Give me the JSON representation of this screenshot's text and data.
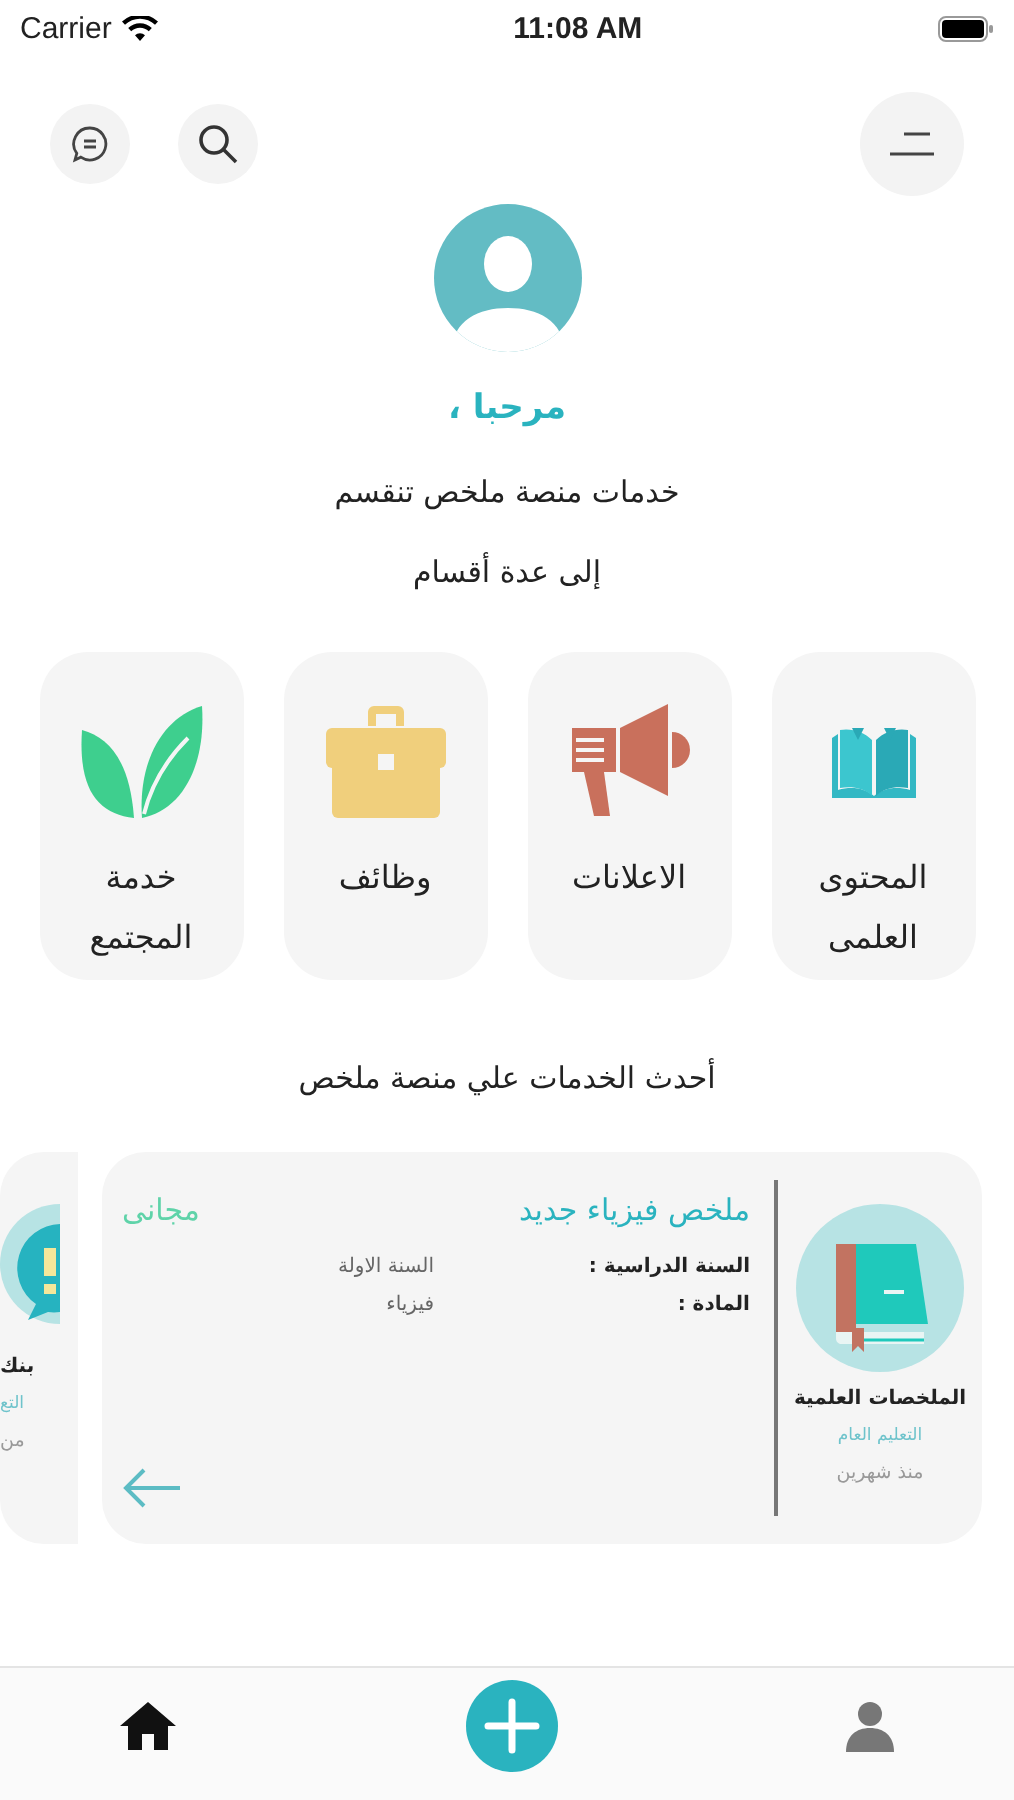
{
  "status_bar": {
    "carrier": "Carrier",
    "time": "11:08 AM"
  },
  "greeting": "مرحبا ،",
  "intro": [
    "خدمات منصة ملخص تنقسم",
    "إلى عدة أقسام"
  ],
  "services": [
    {
      "kind": "book",
      "label": "المحتوى العلمى"
    },
    {
      "kind": "megaphone",
      "label": "الاعلانات"
    },
    {
      "kind": "briefcase",
      "label": "وظائف"
    },
    {
      "kind": "leaf",
      "label": "خدمة المجتمع"
    }
  ],
  "latest_title": "أحدث الخدمات علي منصة ملخص",
  "posts": [
    {
      "kind": "book",
      "category": "الملخصات العلمية",
      "stage": "التعليم العام",
      "time": "منذ شهرين",
      "title": "ملخص فيزياء جديد",
      "price": "مجانى",
      "fields": [
        {
          "label": "السنة الدراسية :",
          "value": "السنة الاولة"
        },
        {
          "label": "المادة :",
          "value": "فيزياء"
        }
      ]
    },
    {
      "kind": "alert",
      "category": "بنك",
      "stage": "التع",
      "time": "من"
    }
  ],
  "nav": [
    {
      "kind": "profile",
      "selected": false
    },
    {
      "kind": "add",
      "selected": false
    },
    {
      "kind": "home",
      "selected": true
    }
  ]
}
